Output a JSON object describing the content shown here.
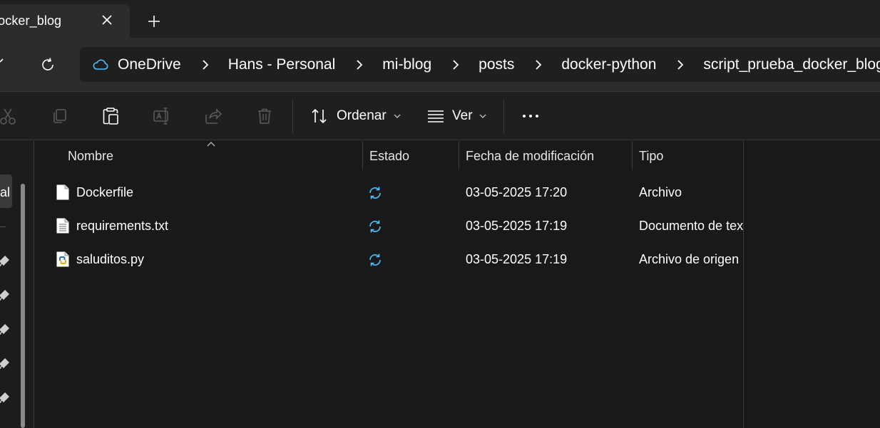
{
  "tab": {
    "title": "docker_blog"
  },
  "address": {
    "crumbs": [
      "OneDrive",
      "Hans - Personal",
      "mi-blog",
      "posts",
      "docker-python",
      "script_prueba_docker_blog"
    ]
  },
  "toolbar": {
    "sort_label": "Ordenar",
    "view_label": "Ver"
  },
  "sidebar": {
    "selected_label": "al"
  },
  "columns": {
    "name": "Nombre",
    "status": "Estado",
    "modified": "Fecha de modificación",
    "type": "Tipo"
  },
  "files": [
    {
      "name": "Dockerfile",
      "modified": "03-05-2025 17:20",
      "type": "Archivo",
      "icon": "generic-file-icon"
    },
    {
      "name": "requirements.txt",
      "modified": "03-05-2025 17:19",
      "type": "Documento de tex",
      "icon": "text-file-icon"
    },
    {
      "name": "saluditos.py",
      "modified": "03-05-2025 17:19",
      "type": "Archivo de origen",
      "icon": "python-file-icon"
    }
  ],
  "colors": {
    "accent": "#4cc2ff",
    "window_bg": "#191919",
    "tabstrip_bg": "#202020",
    "address_row_bg": "#2c2c2c"
  }
}
